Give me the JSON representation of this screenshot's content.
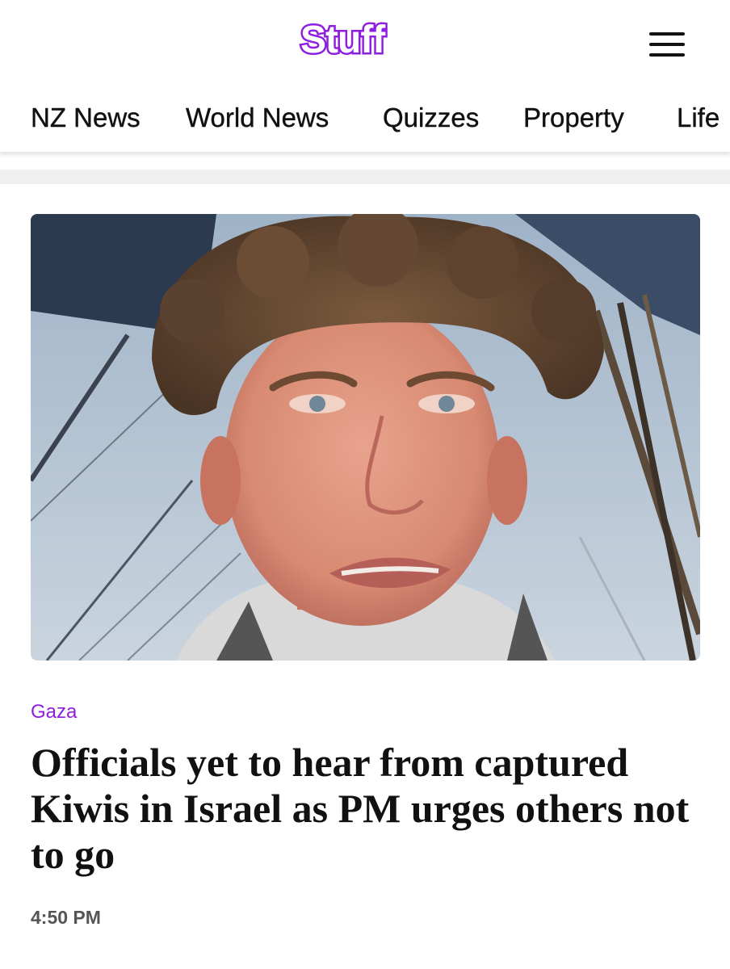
{
  "header": {
    "logo_text": "Stuff",
    "brand_color": "#8f1fe0",
    "menu_icon": "hamburger-menu-icon"
  },
  "nav": {
    "items": [
      {
        "label": "NZ News"
      },
      {
        "label": "World News"
      },
      {
        "label": "Quizzes"
      },
      {
        "label": "Property"
      },
      {
        "label": "Life"
      }
    ]
  },
  "article": {
    "image_alt": "Young man with curly hair aboard a boat",
    "kicker": "Gaza",
    "kicker_color": "#8f1fe0",
    "headline": "Officials yet to hear from captured Kiwis in Israel as PM urges others not to go",
    "time": "4:50 PM"
  }
}
